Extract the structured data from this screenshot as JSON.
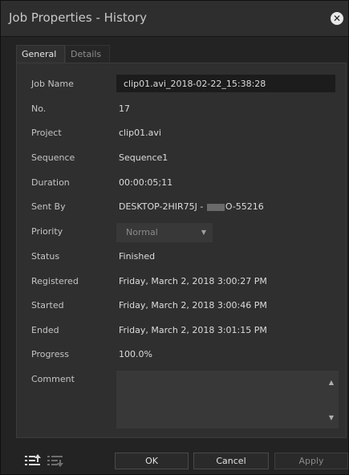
{
  "window": {
    "title": "Job Properties - History"
  },
  "tabs": [
    {
      "label": "General"
    },
    {
      "label": "Details"
    }
  ],
  "fields": {
    "job_name": {
      "label": "Job Name",
      "value": "clip01.avi_2018-02-22_15:38:28"
    },
    "no": {
      "label": "No.",
      "value": "17"
    },
    "project": {
      "label": "Project",
      "value": "clip01.avi"
    },
    "sequence": {
      "label": "Sequence",
      "value": "Sequence1"
    },
    "duration": {
      "label": "Duration",
      "value": "00:00:05;11"
    },
    "sent_by": {
      "label": "Sent By",
      "value_prefix": "DESKTOP-2HIR75J - ",
      "value_suffix": "O-55216"
    },
    "priority": {
      "label": "Priority",
      "value": "Normal"
    },
    "status": {
      "label": "Status",
      "value": "Finished"
    },
    "registered": {
      "label": "Registered",
      "value": "Friday, March 2, 2018 3:00:27 PM"
    },
    "started": {
      "label": "Started",
      "value": "Friday, March 2, 2018 3:00:46 PM"
    },
    "ended": {
      "label": "Ended",
      "value": "Friday, March 2, 2018 3:01:15 PM"
    },
    "progress": {
      "label": "Progress",
      "value": "100.0%"
    },
    "comment": {
      "label": "Comment",
      "value": ""
    }
  },
  "buttons": {
    "ok": "OK",
    "cancel": "Cancel",
    "apply": "Apply"
  },
  "icons": {
    "close": "close-icon",
    "list_up": "list-move-up-icon",
    "list_down": "list-move-down-icon"
  }
}
